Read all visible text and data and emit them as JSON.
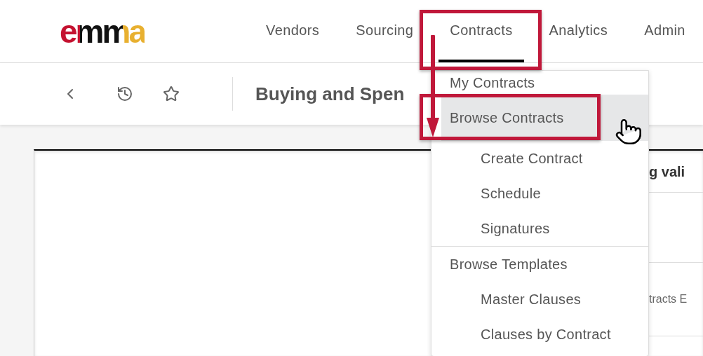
{
  "logo": {
    "text": "emma"
  },
  "nav": [
    {
      "label": "Vendors",
      "selected": false
    },
    {
      "label": "Sourcing",
      "selected": false
    },
    {
      "label": "Contracts",
      "selected": true
    },
    {
      "label": "Analytics",
      "selected": false
    },
    {
      "label": "Admin",
      "selected": false
    }
  ],
  "toolbar": {
    "title": "Buying and Spen"
  },
  "menu": {
    "items": [
      {
        "label": "My Contracts",
        "indented": false,
        "selected": false,
        "divider_before": false
      },
      {
        "label": "Browse Contracts",
        "indented": false,
        "selected": true,
        "divider_before": false
      },
      {
        "label": "Create Contract",
        "indented": true,
        "selected": false,
        "divider_before": false
      },
      {
        "label": "Schedule",
        "indented": true,
        "selected": false,
        "divider_before": false
      },
      {
        "label": "Signatures",
        "indented": true,
        "selected": false,
        "divider_before": false
      },
      {
        "label": "Browse Templates",
        "indented": false,
        "selected": false,
        "divider_before": true
      },
      {
        "label": "Master Clauses",
        "indented": true,
        "selected": false,
        "divider_before": false
      },
      {
        "label": "Clauses by Contract",
        "indented": true,
        "selected": false,
        "divider_before": false
      }
    ]
  },
  "content": {
    "heading": "g vali",
    "row_text": "tracts E"
  }
}
